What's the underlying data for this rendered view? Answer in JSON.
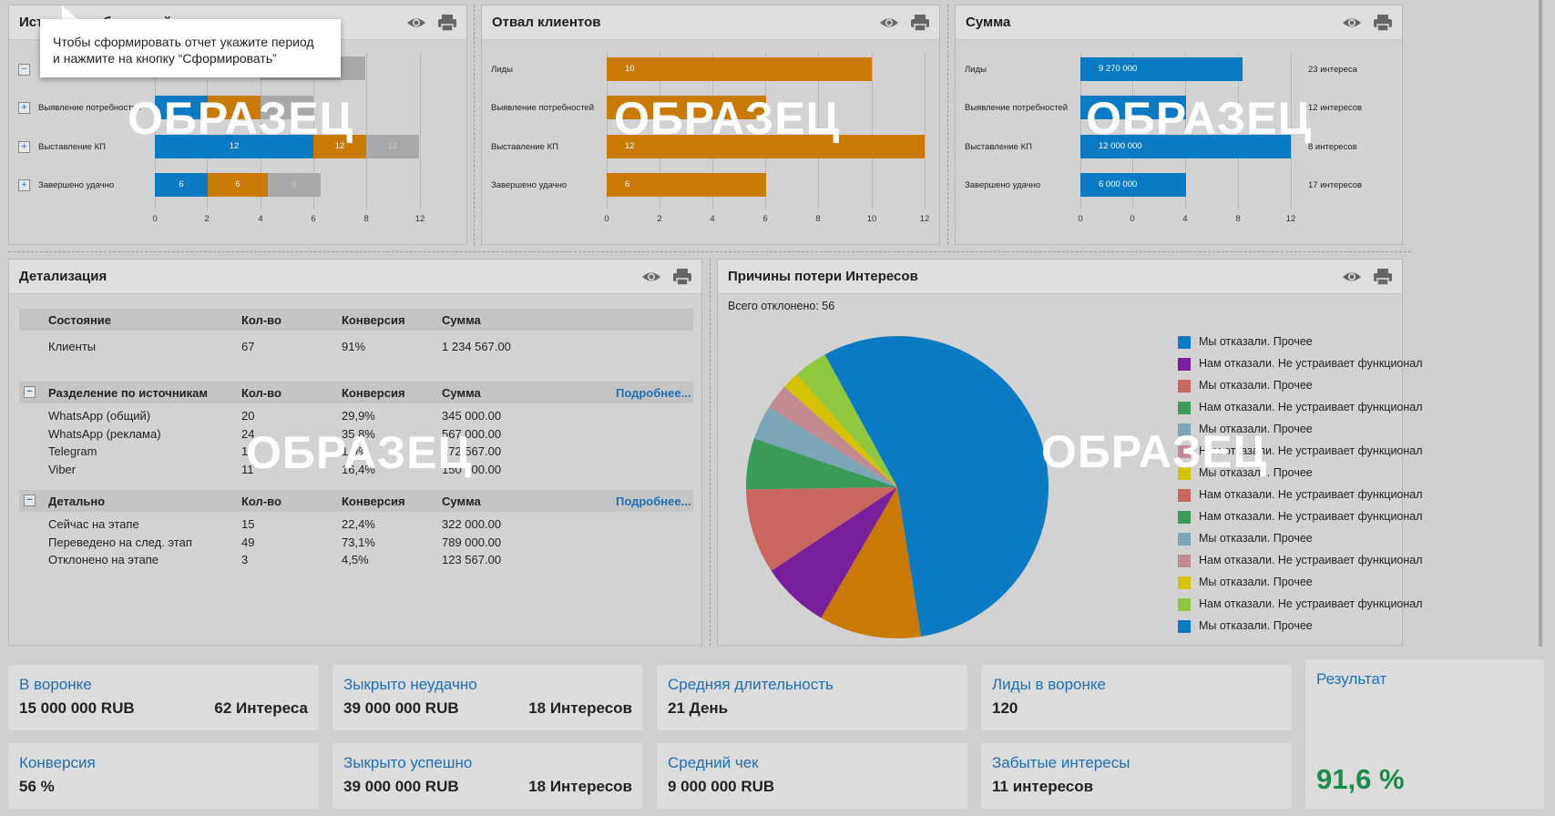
{
  "panels": {
    "sources": {
      "title": "Источники обращений"
    },
    "churn": {
      "title": "Отвал клиентов"
    },
    "sum": {
      "title": "Сумма"
    },
    "detail": {
      "title": "Детализация"
    },
    "reasons": {
      "title": "Причины потери Интересов"
    }
  },
  "watermark": "ОБРАЗЕЦ",
  "tooltip": {
    "line1": "Чтобы сформировать отчет укажите период",
    "line2": "и нажмите на кнопку “Сформировать”"
  },
  "colors": {
    "blue": "#0a7bc2",
    "orange": "#c97a05",
    "gray": "#a8a8a8",
    "accent": "#1f6fb3",
    "result_green": "#1e8a4a"
  },
  "chart_data": [
    {
      "type": "bar",
      "stacked": true,
      "categories": [
        "",
        "Выявление потребностей",
        "Выставление КП",
        "Завершено удачно"
      ],
      "series": [
        {
          "values": [
            null,
            null,
            12,
            6
          ]
        },
        {
          "values": [
            null,
            null,
            12,
            6
          ]
        },
        {
          "values": [
            null,
            null,
            12,
            6
          ]
        }
      ],
      "x_ticks": [
        "0",
        "2",
        "4",
        "6",
        "8",
        "12"
      ]
    },
    {
      "type": "bar",
      "title": "Отвал клиентов",
      "categories": [
        "Лиды",
        "Выявление потребностей",
        "Выставление КП",
        "Завершено удачно"
      ],
      "values": [
        10,
        6,
        12,
        6
      ],
      "x_ticks": [
        "0",
        "2",
        "4",
        "6",
        "8",
        "10",
        "12"
      ]
    },
    {
      "type": "bar",
      "title": "Сумма",
      "categories": [
        "Лиды",
        "Выявление потребностей",
        "Выставление КП",
        "Завершено удачно"
      ],
      "values": [
        9270000,
        6000000,
        12000000,
        6000000
      ],
      "value_labels": [
        "9 270 000",
        "",
        "12 000 000",
        "6 000 000"
      ],
      "right_labels": [
        "23 интереса",
        "12 интересов",
        "8 интересов",
        "17 интересов"
      ],
      "x_ticks": [
        "0",
        "0",
        "4",
        "8",
        "12"
      ]
    },
    {
      "type": "pie",
      "title": "Причины потери Интересов",
      "subtitle": "Всего отклонено: 56",
      "labels": [
        "Мы отказали. Прочее",
        "Нам отказали. Не устраивает функционал",
        "Мы отказали. Прочее",
        "Нам отказали. Не устраивает функционал",
        "Мы отказали. Прочее",
        "Нам отказали. Не устраивает функционал",
        "Мы отказали. Прочее",
        "Нам отказали. Не устраивает функционал",
        "Нам отказали. Не устраивает функционал",
        "Мы отказали. Прочее",
        "Нам отказали. Не устраивает функционал",
        "Мы отказали. Прочее",
        "Нам отказали. Не устраивает функционал",
        "Мы отказали. Прочее"
      ],
      "slice_colors": [
        "#0a7bc2",
        "#c97a05",
        "#7a1f9c",
        "#c9665e",
        "#3a9a5a",
        "#7aa5b5",
        "#c08a90",
        "#d4c200",
        "#8fc73e"
      ],
      "values": [
        61,
        12,
        8,
        10,
        6,
        4,
        3,
        2,
        4
      ],
      "legend_colors": [
        "#0a7bc2",
        "#7a1f9c",
        "#c9665e",
        "#3a9a5a",
        "#7aa5b5",
        "#c08a90",
        "#d4c200",
        "#c9665e",
        "#3a9a5a",
        "#7aa5b5",
        "#c08a90",
        "#d4c200",
        "#8fc73e",
        "#0a7bc2"
      ]
    }
  ],
  "detail_table": {
    "header1": [
      "Состояние",
      "Кол-во",
      "Конверсия",
      "Сумма"
    ],
    "row1": [
      "Клиенты",
      "67",
      "91%",
      "1 234 567.00"
    ],
    "section2": {
      "title": "Разделение по источникам",
      "cols": [
        "Кол-во",
        "Конверсия",
        "Сумма"
      ],
      "link": "Подробнее..."
    },
    "rows2": [
      [
        "WhatsApp (общий)",
        "20",
        "29,9%",
        "345 000.00"
      ],
      [
        "WhatsApp (реклама)",
        "24",
        "35,8%",
        "567 000.00"
      ],
      [
        "Telegram",
        "1",
        "1,9%",
        "172 567.00"
      ],
      [
        "Viber",
        "11",
        "16,4%",
        "150 000.00"
      ]
    ],
    "section3": {
      "title": "Детально",
      "cols": [
        "Кол-во",
        "Конверсия",
        "Сумма"
      ],
      "link": "Подробнее..."
    },
    "rows3": [
      [
        "Сейчас на этапе",
        "15",
        "22,4%",
        "322 000.00"
      ],
      [
        "Переведено на след. этап",
        "49",
        "73,1%",
        "789 000.00"
      ],
      [
        "Отклонено на этапе",
        "3",
        "4,5%",
        "123 567.00"
      ]
    ]
  },
  "cards": {
    "funnel": {
      "title": "В воронке",
      "value": "15 000 000 RUB",
      "right": "62 Интереса"
    },
    "closed_fail": {
      "title": "Зыкрыто неудачно",
      "value": "39 000 000 RUB",
      "right": "18 Интересов"
    },
    "avg_duration": {
      "title": "Средняя длительность",
      "value": "21 День"
    },
    "leads": {
      "title": "Лиды в воронке",
      "value": "120"
    },
    "conversion": {
      "title": "Конверсия",
      "value": "56 %"
    },
    "closed_ok": {
      "title": "Зыкрыто успешно",
      "value": "39 000 000 RUB",
      "right": "18 Интересов"
    },
    "avg_check": {
      "title": "Средний чек",
      "value": "9 000 000 RUB"
    },
    "forgotten": {
      "title": "Забытые интересы",
      "value": "11 интересов"
    },
    "result": {
      "title": "Результат",
      "value": "91,6 %"
    }
  }
}
